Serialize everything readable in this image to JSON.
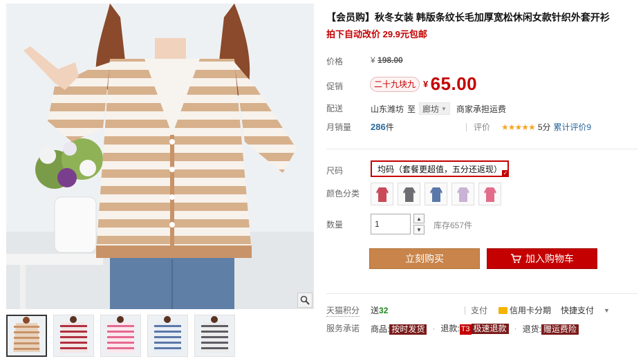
{
  "product": {
    "title": "【会员购】秋冬女装 韩版条纹长毛加厚宽松休闲女款针织外套开衫",
    "subtitle": "拍下自动改价 29.9元包邮"
  },
  "price": {
    "label": "价格",
    "currency": "¥",
    "original": "198.00"
  },
  "promo": {
    "label": "促销",
    "tag": "二十九块九",
    "currency": "¥",
    "price": "65.00"
  },
  "shipping": {
    "label": "配送",
    "from": "山东潍坊",
    "to_word": "至",
    "city": "廊坊",
    "note": "商家承担运费"
  },
  "sales": {
    "label": "月销量",
    "count": "286",
    "unit": "件",
    "rating_label": "评价",
    "stars": "★★★★★",
    "score": "5分",
    "total_reviews": "累计评价9"
  },
  "size": {
    "label": "尺码",
    "selected": "均码（套餐更超值，五分还返现）"
  },
  "color": {
    "label": "颜色分类",
    "swatches": [
      {
        "name": "red",
        "color": "#c94a58"
      },
      {
        "name": "grey",
        "color": "#6d6d72"
      },
      {
        "name": "blue",
        "color": "#5a78a8"
      },
      {
        "name": "lavender",
        "color": "#c9b3d4"
      },
      {
        "name": "pink",
        "color": "#e36c8a"
      }
    ]
  },
  "quantity": {
    "label": "数量",
    "value": "1",
    "stock": "库存657件"
  },
  "buttons": {
    "buy_now": "立刻购买",
    "add_cart": "加入购物车"
  },
  "points": {
    "label": "天猫积分",
    "prefix": "送",
    "value": "32"
  },
  "payment": {
    "label": "支付",
    "credit": "信用卡分期",
    "quick": "快捷支付"
  },
  "service": {
    "label": "服务承诺",
    "goods_label": "商品:",
    "goods_tag": "按时发货",
    "refund_label": "退款:",
    "refund_badge": "T3",
    "refund_tag": "极速退款",
    "return_label": "退货:",
    "return_tag": "赠运费险"
  },
  "colors": {
    "accent": "#c40000",
    "buy_now_bg": "#c8844a",
    "link_blue": "#28679b",
    "star": "#f5a623",
    "points_green": "#1f8a1f"
  },
  "icons": {
    "zoom": "magnifier-icon",
    "cart": "cart-icon",
    "card": "credit-card-icon"
  }
}
